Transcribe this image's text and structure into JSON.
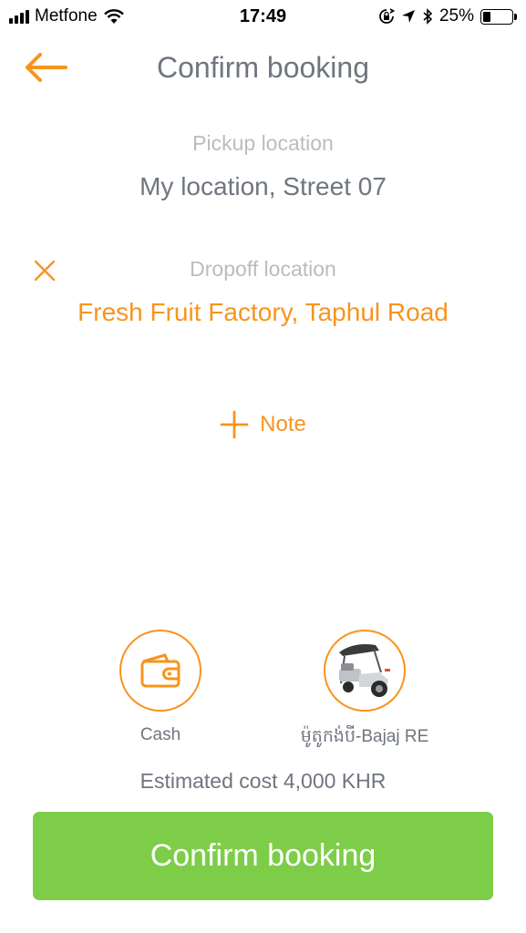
{
  "status_bar": {
    "carrier": "Metfone",
    "time": "17:49",
    "battery": "25%",
    "battery_level": 0.25,
    "icons": [
      "signal-icon",
      "wifi-icon",
      "rotation-lock-icon",
      "location-arrow-icon",
      "bluetooth-icon",
      "battery-icon"
    ]
  },
  "header": {
    "title": "Confirm booking",
    "back_icon": "arrow-left-icon"
  },
  "pickup": {
    "label": "Pickup location",
    "value": "My location, Street 07"
  },
  "dropoff": {
    "label": "Dropoff location",
    "value": "Fresh Fruit Factory, Taphul Road",
    "clear_icon": "close-icon"
  },
  "note": {
    "label": "Note",
    "icon": "plus-icon"
  },
  "payment": {
    "label": "Cash",
    "icon": "wallet-icon"
  },
  "vehicle": {
    "label": "ម៉ូតូកង់បី-Bajaj RE",
    "icon": "tuk-tuk-image"
  },
  "estimate": {
    "text": "Estimated cost 4,000 KHR"
  },
  "confirm": {
    "label": "Confirm booking"
  },
  "colors": {
    "accent": "#f7941d",
    "primary_button": "#7ecd49",
    "text": "#6f7580",
    "muted": "#b9bcc2"
  }
}
